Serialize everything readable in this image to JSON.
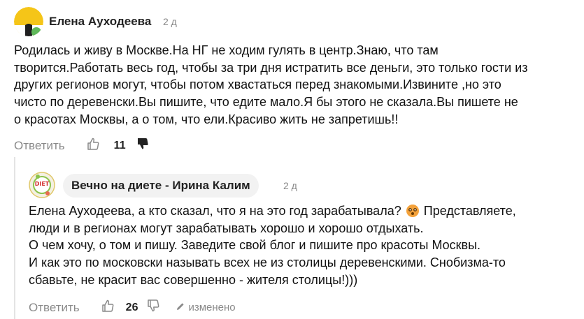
{
  "comments": [
    {
      "author": "Елена Ауходеева",
      "time": "2 д",
      "lines": [
        "Родилась и живу в Москве.На НГ не ходим гулять в центр.Знаю, что там",
        "творится.Работать весь год, чтобы за три дня истратить все деньги, это только гости из",
        "других регионов могут, чтобы потом хвастаться перед знакомыми.Извините ,но это",
        "чисто по деревенски.Вы пишите, что едите мало.Я бы этого не сказала.Вы пишете не",
        "о красотах Москвы, а о том, что ели.Красиво жить не запретишь!!"
      ],
      "reply_label": "Ответить",
      "likes": "11"
    },
    {
      "author": "Вечно на диете - Ирина Калим",
      "avatar_text": "DIET",
      "time": "2 д",
      "line1_before": "Елена Ауходеева, а кто сказал, что я на это год зарабатывала?",
      "line1_after": "Представляете,",
      "lines": [
        "люди и в регионах могут зарабатывать хорошо и хорошо отдыхать.",
        "О чем хочу, о том и пишу. Заведите свой блог и пишите про красоты Москвы.",
        "И как это по московски называть всех не из столицы деревенскими. Снобизма-то",
        "сбавьте, не красит вас совершенно - жителя столицы!)))"
      ],
      "reply_label": "Ответить",
      "likes": "26",
      "edited_label": "изменено"
    }
  ]
}
